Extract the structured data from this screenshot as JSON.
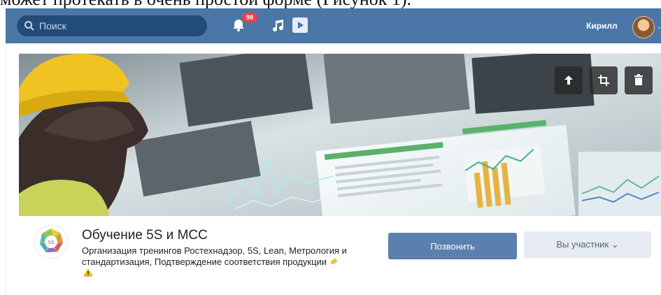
{
  "document": {
    "top_text": "может протекать в очень простой форме (Рисунок 1)."
  },
  "header": {
    "search_placeholder": "Поиск",
    "notifications_count": "99",
    "username": "Кирилл",
    "colors": {
      "bar": "#4a76a8",
      "search_bg": "#224b7a",
      "badge": "#e64646"
    },
    "icons": [
      "search-icon",
      "bell-icon",
      "music-icon",
      "video-icon",
      "avatar",
      "chevron-down-icon"
    ]
  },
  "cover": {
    "actions": [
      "upload-icon",
      "crop-icon",
      "trash-icon"
    ]
  },
  "group": {
    "title": "Обучение 5S и МСС",
    "description": "Организация тренингов Ростехнадзор, 5S, Lean, Метрология и стандартизация, Подтверждение соответствия продукции",
    "emojis": [
      "muscle-emoji-icon",
      "warning-emoji-icon"
    ]
  },
  "buttons": {
    "call": "Позвонить",
    "member": "Вы участник ⌄",
    "colors": {
      "call_bg": "#5b7fae",
      "member_bg": "#e5ebf1"
    }
  }
}
